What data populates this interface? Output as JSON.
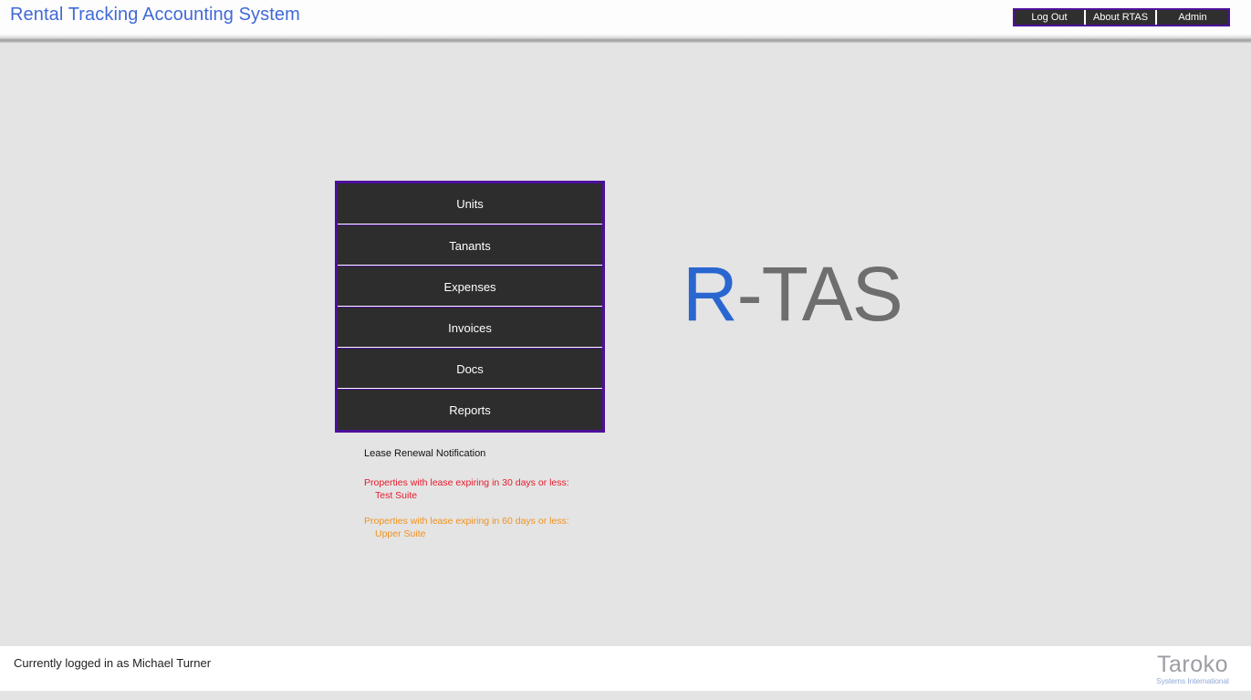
{
  "header": {
    "title": "Rental Tracking Accounting System",
    "nav": [
      {
        "id": "log-out",
        "label": "Log Out"
      },
      {
        "id": "about-rtas",
        "label": "About RTAS"
      },
      {
        "id": "admin",
        "label": "Admin"
      }
    ],
    "colors": {
      "title_color": "#4169d8",
      "nav_border": "#4c0f9b",
      "nav_background": "#2f2f2f",
      "nav_text": "#ffffff"
    }
  },
  "main_menu": {
    "items": [
      {
        "id": "units",
        "label": "Units"
      },
      {
        "id": "tanants",
        "label": "Tanants"
      },
      {
        "id": "expenses",
        "label": "Expenses"
      },
      {
        "id": "invoices",
        "label": "Invoices"
      },
      {
        "id": "docs",
        "label": "Docs"
      },
      {
        "id": "reports",
        "label": "Reports"
      }
    ],
    "colors": {
      "border": "#4c0f9b",
      "button_background": "#2d2d2d",
      "button_text": "#ffffff"
    }
  },
  "notifications": {
    "title": "Lease Renewal Notification",
    "groups": [
      {
        "id": "expiring-30-days",
        "heading": "Properties with lease expiring in 30 days or less:",
        "items": [
          "Test Suite"
        ],
        "color": "#e8192c"
      },
      {
        "id": "expiring-60-days",
        "heading": "Properties with lease expiring in 60 days or less:",
        "items": [
          "Upper Suite"
        ],
        "color": "#f0921e"
      }
    ]
  },
  "branding": {
    "wordmark_r": "R",
    "wordmark_tas": "-TAS",
    "wordmark_r_color": "#2a66d0",
    "wordmark_tas_color": "#6e6e6e"
  },
  "footer": {
    "logged_in_text": "Currently logged in as Michael Turner",
    "vendor_name": "Taroko",
    "vendor_tagline": "Systems International",
    "vendor_name_color": "#9d9da5",
    "vendor_tagline_color": "#8fa9d8"
  },
  "page": {
    "background_color": "#e4e4e4",
    "header_background_color": "#fdfdfd",
    "footer_background_color": "#ffffff"
  }
}
